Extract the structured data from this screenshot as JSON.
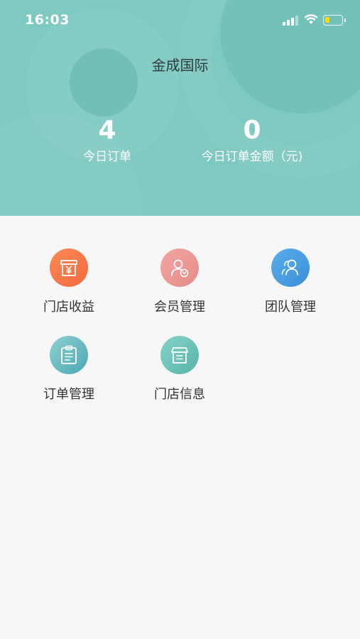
{
  "status_bar": {
    "time": "16:03"
  },
  "header": {
    "store_name": "金成国际",
    "stats": [
      {
        "value": "4",
        "label": "今日订单"
      },
      {
        "value": "0",
        "label": "今日订单金额（元)"
      }
    ]
  },
  "menu": {
    "items": [
      {
        "label": "门店收益",
        "icon": "store-yuan-icon"
      },
      {
        "label": "会员管理",
        "icon": "member-icon"
      },
      {
        "label": "团队管理",
        "icon": "team-icon"
      },
      {
        "label": "订单管理",
        "icon": "clipboard-icon"
      },
      {
        "label": "门店信息",
        "icon": "store-box-icon"
      }
    ]
  },
  "colors": {
    "header_bg": "#7ec9c1",
    "page_bg": "#f7f7f7",
    "revenue": "#f47a49",
    "member": "#ec9896",
    "team": "#4a9ee2",
    "orders": "#6cbcc2",
    "info": "#6cc4b8"
  }
}
